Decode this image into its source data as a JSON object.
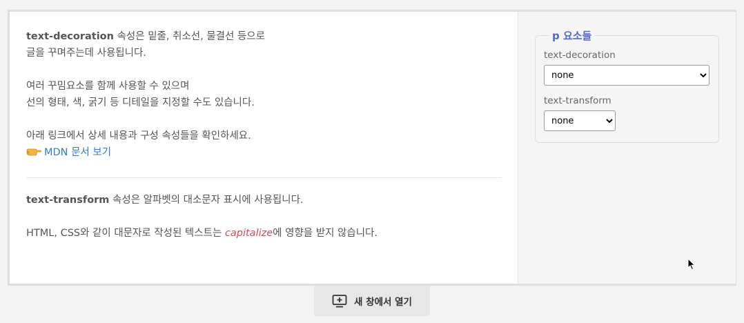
{
  "content": {
    "decoration_intro": {
      "term": "text-decoration",
      "line1_rest": " 속성은 밑줄, 취소선, 물결선 등으로",
      "line2": "글을 꾸며주는데 사용됩니다."
    },
    "decoration_detail": {
      "line1": "여러 꾸밈요소를 함께 사용할 수 있으며",
      "line2": "선의 형태, 색, 굵기 등 디테일을 지정할 수도 있습니다."
    },
    "link_section": {
      "line1": "아래 링크에서 상세 내용과 구성 속성들을 확인하세요.",
      "link_icon": "pointing-hand-icon",
      "link_text": "MDN 문서 보기"
    },
    "transform_intro": {
      "term": "text-transform",
      "rest": " 속성은 알파벳의 대소문자 표시에 사용됩니다."
    },
    "transform_detail": {
      "before": "HTML, CSS와 같이 대문자로 작성된 텍스트는 ",
      "accent": "capitalize",
      "after": "에 영향을 받지 않습니다."
    }
  },
  "sidebar": {
    "legend": "p 요소들",
    "fields": [
      {
        "label": "text-decoration",
        "value": "none"
      },
      {
        "label": "text-transform",
        "value": "none"
      }
    ]
  },
  "open_button": {
    "icon": "new-window-icon",
    "label": "새 창에서 열기"
  },
  "colors": {
    "link": "#2f7bd1",
    "accent": "#d24b55",
    "legend": "#5865c9"
  }
}
